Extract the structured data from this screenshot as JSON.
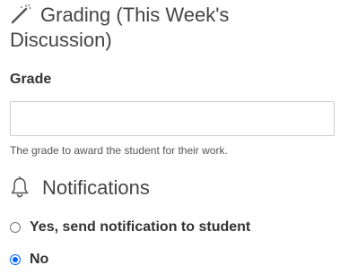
{
  "grading": {
    "heading": "Grading (This Week's Discussion)",
    "icon": "magic-wand-icon"
  },
  "grade_field": {
    "label": "Grade",
    "value": "",
    "help_text": "The grade to award the student for their work."
  },
  "notifications": {
    "heading": "Notifications",
    "icon": "bell-icon",
    "options": [
      {
        "label": "Yes, send notification to student",
        "selected": false
      },
      {
        "label": "No",
        "selected": true
      }
    ]
  },
  "colors": {
    "accent": "#0066ff",
    "heading_text": "#444444",
    "input_border": "#cccccc"
  }
}
